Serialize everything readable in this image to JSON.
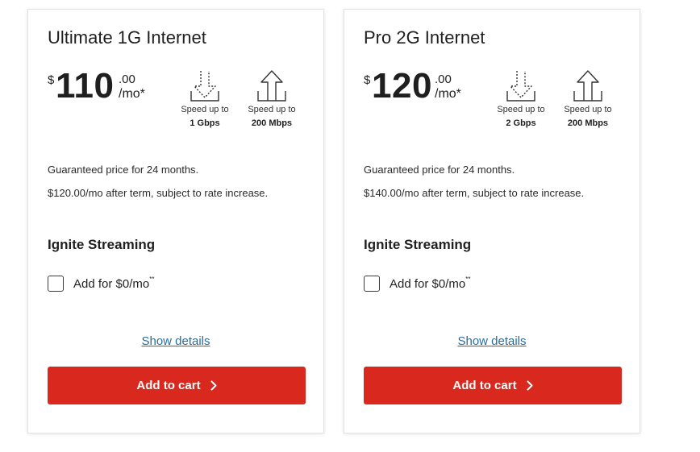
{
  "plans": [
    {
      "title": "Ultimate 1G Internet",
      "price": {
        "currency": "$",
        "amount": "110",
        "cents": ".00",
        "per": "/mo*"
      },
      "download": {
        "label": "Speed up to",
        "value": "1 Gbps"
      },
      "upload": {
        "label": "Speed up to",
        "value": "200 Mbps"
      },
      "notes": [
        "Guaranteed price for 24 months.",
        "$120.00/mo after term, subject to rate increase."
      ],
      "addon": {
        "title": "Ignite Streaming",
        "label": "Add for $0/mo",
        "sup": "**",
        "checked": false
      },
      "details_link": "Show details",
      "cart_button": "Add to cart"
    },
    {
      "title": "Pro 2G Internet",
      "price": {
        "currency": "$",
        "amount": "120",
        "cents": ".00",
        "per": "/mo*"
      },
      "download": {
        "label": "Speed up to",
        "value": "2 Gbps"
      },
      "upload": {
        "label": "Speed up to",
        "value": "200 Mbps"
      },
      "notes": [
        "Guaranteed price for 24 months.",
        "$140.00/mo after term, subject to rate increase."
      ],
      "addon": {
        "title": "Ignite Streaming",
        "label": "Add for $0/mo",
        "sup": "**",
        "checked": false
      },
      "details_link": "Show details",
      "cart_button": "Add to cart"
    }
  ],
  "icons": {
    "download": "download-arrow-icon",
    "upload": "upload-arrow-icon",
    "chevron": "chevron-right-icon"
  },
  "colors": {
    "cart_button": "#d9281e",
    "link": "#2a6d9b",
    "card_border": "#e2e2e2"
  }
}
